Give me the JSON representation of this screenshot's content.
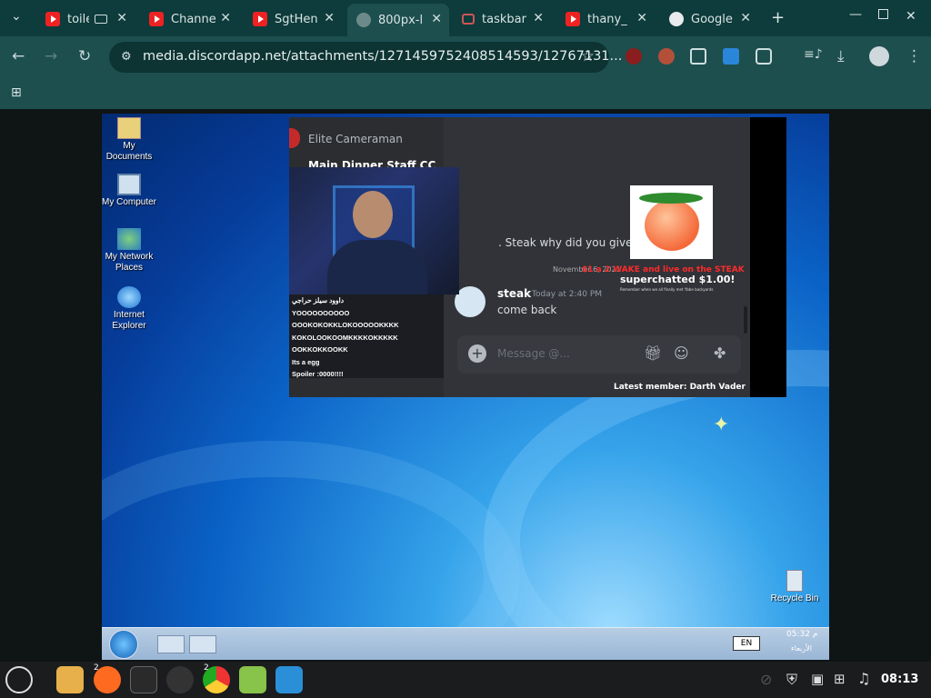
{
  "browser": {
    "tabs": [
      {
        "title": "toile",
        "favicon": "youtube-icon"
      },
      {
        "title": "Channe",
        "favicon": "youtube-icon"
      },
      {
        "title": "SgtHen",
        "favicon": "youtube-icon"
      },
      {
        "title": "800px-l",
        "favicon": "globe-icon"
      },
      {
        "title": "taskbar",
        "favicon": "image-icon"
      },
      {
        "title": "thany_",
        "favicon": "youtube-icon"
      },
      {
        "title": "Google",
        "favicon": "google-icon"
      }
    ],
    "address": "media.discordapp.net/attachments/1271459752408514593/12767131..."
  },
  "desktop": {
    "icons": [
      "My Documents",
      "My Computer",
      "My Network Places",
      "Internet Explorer"
    ],
    "recycle_bin": "Recycle Bin",
    "tray_time": "05:32 م",
    "tray_day": "الأربعاء",
    "tray_lang": "EN"
  },
  "discord": {
    "channel_1": "Elite Cameraman",
    "channel_2": "Main Dinner Staff CC",
    "message_1": ". Steak why did you give up",
    "date_sep": "November 6, 2021",
    "author": "steak",
    "author_time": "Today at 2:40 PM",
    "message_2": "come back",
    "input_placeholder": "Message @...",
    "superchat": "superchatted $1.00!",
    "superchat_sub": "Remember when we all finally met Ybbe backyards",
    "overlay_red": "$1 a 2 WAKE and live on the STEAK",
    "latest_member": "Latest member: Darth Vader",
    "chat_lines": [
      "داوود سيلز حراجي",
      "YOOOOOOOOOO",
      "OOOKOKOKKLOKOOOOOKKKK",
      "KOKOLOOKOOMKKKKOKKKKK",
      "OOKKOKKOOKK",
      "Its a egg",
      "Spoiler :0000!!!!"
    ]
  },
  "taskbar": {
    "clock": "08:13",
    "badges": [
      "2",
      "2"
    ]
  },
  "colors": {
    "tabstrip": "#0e3b3b",
    "toolbar": "#1d4f4f",
    "mint_panel": "#1b1c1e"
  }
}
